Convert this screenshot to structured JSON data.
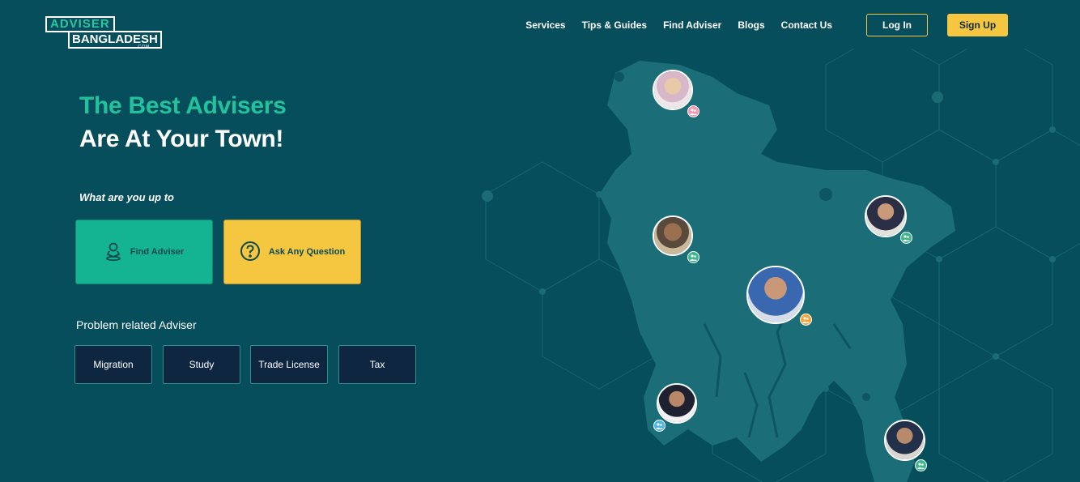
{
  "logo": {
    "top_text": "ADVISER",
    "bottom_text": "BANGLADESH",
    "suffix": ".COM"
  },
  "nav": {
    "items": [
      {
        "label": "Services"
      },
      {
        "label": "Tips & Guides"
      },
      {
        "label": "Find Adviser"
      },
      {
        "label": "Blogs"
      },
      {
        "label": "Contact Us"
      }
    ],
    "login_label": "Log In",
    "signup_label": "Sign Up"
  },
  "hero": {
    "title_line1": "The Best Advisers",
    "title_line2": "Are At Your Town!",
    "prompt": "What are you up to"
  },
  "actions": {
    "find_label": "Find Adviser",
    "ask_label": "Ask Any Question"
  },
  "problems": {
    "heading": "Problem related Adviser",
    "tags": [
      "Migration",
      "Study",
      "Trade License",
      "Tax"
    ]
  },
  "icons": {
    "find": "person-pin-icon",
    "ask": "question-circle-icon",
    "badge": "users-icon"
  },
  "colors": {
    "background": "#064e5c",
    "accent_green": "#22c39c",
    "accent_yellow": "#f5c63f",
    "tag_bg": "#0e2640",
    "map": "#1b6e78"
  },
  "advisers": [
    {
      "badge_color": "#f29ab2"
    },
    {
      "badge_color": "#3fb58a"
    },
    {
      "badge_color": "#3fb58a"
    },
    {
      "badge_color": "#f3a43b"
    },
    {
      "badge_color": "#4bb6e3"
    },
    {
      "badge_color": "#3fb58a"
    }
  ]
}
